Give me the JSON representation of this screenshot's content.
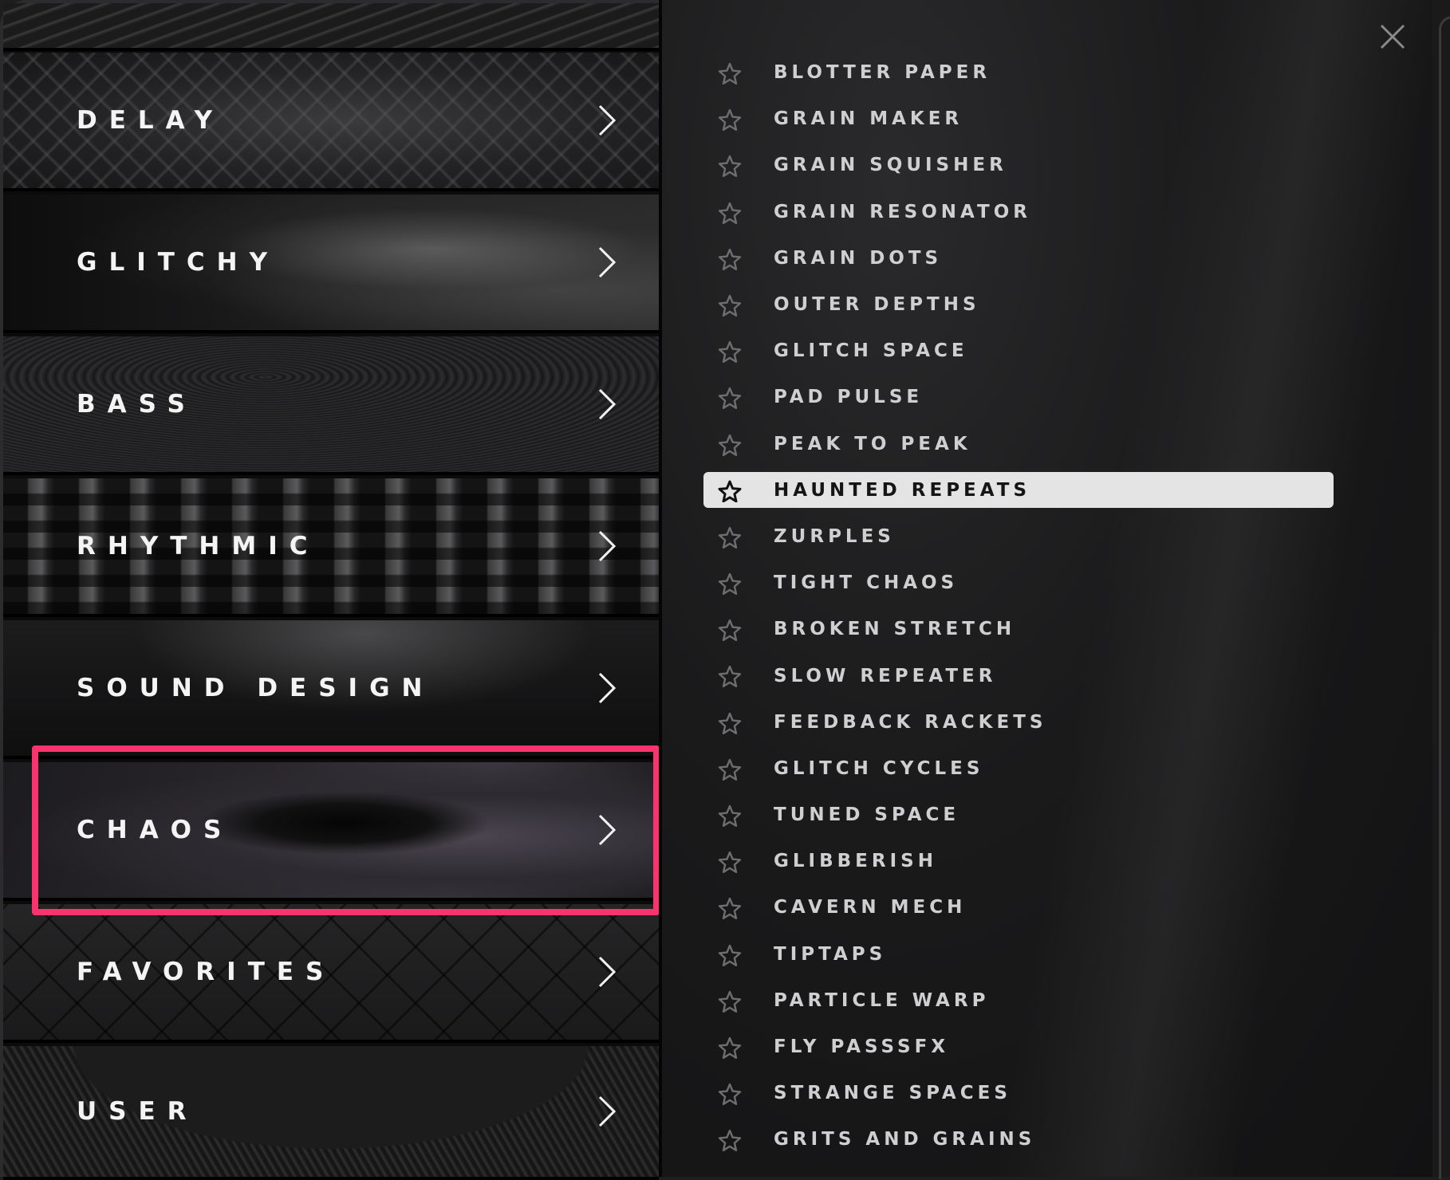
{
  "categories": [
    {
      "label": "DELAY"
    },
    {
      "label": "GLITCHY"
    },
    {
      "label": "BASS"
    },
    {
      "label": "RHYTHMIC"
    },
    {
      "label": "SOUND DESIGN"
    },
    {
      "label": "CHAOS"
    },
    {
      "label": "FAVORITES"
    },
    {
      "label": "USER"
    }
  ],
  "highlighted_category": "CHAOS",
  "presets": [
    {
      "name": "BLOTTER PAPER"
    },
    {
      "name": "GRAIN MAKER"
    },
    {
      "name": "GRAIN SQUISHER"
    },
    {
      "name": "GRAIN RESONATOR"
    },
    {
      "name": "GRAIN DOTS"
    },
    {
      "name": "OUTER DEPTHS"
    },
    {
      "name": "GLITCH SPACE"
    },
    {
      "name": "PAD PULSE"
    },
    {
      "name": "PEAK TO PEAK"
    },
    {
      "name": "HAUNTED REPEATS"
    },
    {
      "name": "ZURPLES"
    },
    {
      "name": "TIGHT CHAOS"
    },
    {
      "name": "BROKEN STRETCH"
    },
    {
      "name": "SLOW REPEATER"
    },
    {
      "name": "FEEDBACK RACKETS"
    },
    {
      "name": "GLITCH CYCLES"
    },
    {
      "name": "TUNED SPACE"
    },
    {
      "name": "GLIBBERISH"
    },
    {
      "name": "CAVERN MECH"
    },
    {
      "name": "TIPTAPS"
    },
    {
      "name": "PARTICLE WARP"
    },
    {
      "name": "FLY PASSSFX"
    },
    {
      "name": "STRANGE SPACES"
    },
    {
      "name": "GRITS AND GRAINS"
    }
  ],
  "selected_preset": "HAUNTED REPEATS",
  "colors": {
    "highlight_border": "#f7346d",
    "selected_row_bg": "#e4e4e5",
    "preset_text": "#cfcfd1",
    "category_text": "#f4f4f4"
  },
  "icons": {
    "close": "close-icon",
    "chevron": "chevron-right-icon",
    "star": "star-outline-icon"
  }
}
